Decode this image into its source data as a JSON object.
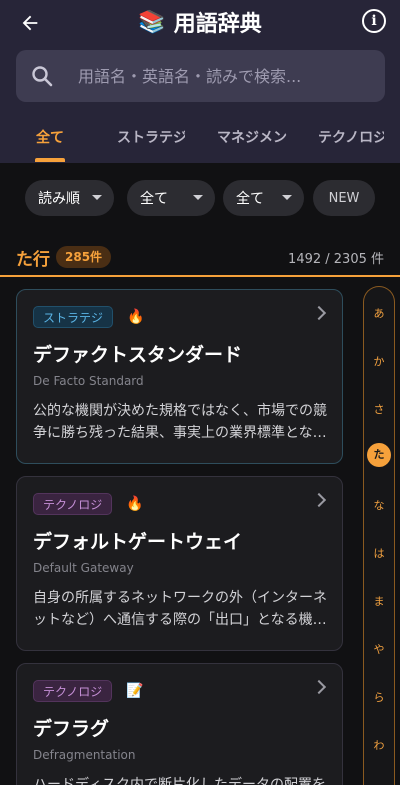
{
  "header": {
    "title": "用語辞典",
    "title_emoji": "📚",
    "back_icon": "arrow-left-icon",
    "info_icon": "info-icon"
  },
  "search": {
    "placeholder": "用語名・英語名・読みで検索...",
    "icon": "search-icon"
  },
  "tabs": [
    {
      "label": "全て",
      "active": true
    },
    {
      "label": "ストラテジ",
      "active": false
    },
    {
      "label": "マネジメント",
      "active": false
    },
    {
      "label": "テクノロジ",
      "active": false
    }
  ],
  "filters": {
    "sort": "読み順",
    "category": "全て",
    "status": "全て",
    "new_label": "NEW"
  },
  "section": {
    "title": "た行",
    "count_badge": "285件",
    "total": "1492 / 2305 件"
  },
  "cards": [
    {
      "category": "ストラテジ",
      "status_emoji": "🔥",
      "term": "デファクトスタンダード",
      "english": "De Facto Standard",
      "description": "公的な機関が決めた規格ではなく、市場での競争に勝ち残った結果、事実上の業界標準とな…"
    },
    {
      "category": "テクノロジ",
      "status_emoji": "🔥",
      "term": "デフォルトゲートウェイ",
      "english": "Default Gateway",
      "description": "自身の所属するネットワークの外（インターネットなど）へ通信する際の「出口」となる機…"
    },
    {
      "category": "テクノロジ",
      "status_emoji": "📝",
      "term": "デフラグ",
      "english": "Defragmentation",
      "description": "ハードディスク内で断片化したデータの配置を"
    }
  ],
  "index": [
    "あ",
    "か",
    "さ",
    "た",
    "な",
    "は",
    "ま",
    "や",
    "ら",
    "わ"
  ],
  "index_active": "た",
  "colors": {
    "accent": "#f6a13b",
    "header_bg": "#272538",
    "background": "#111113"
  }
}
